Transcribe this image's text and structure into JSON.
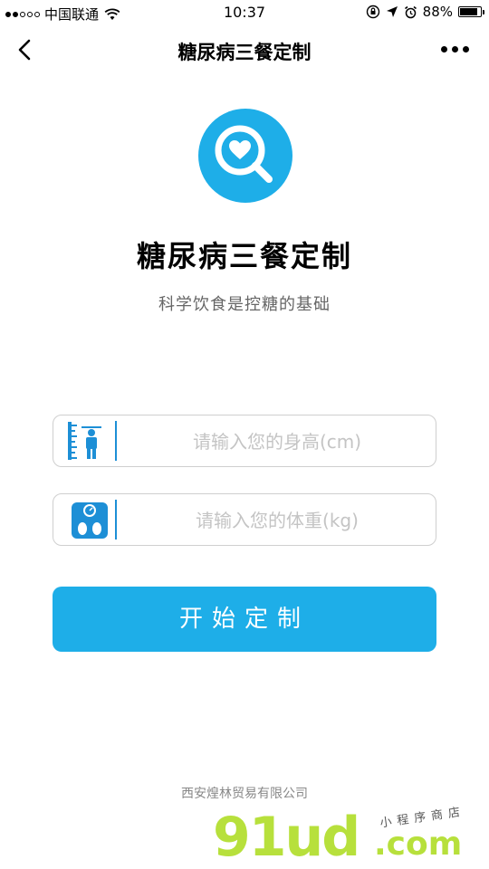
{
  "status_bar": {
    "carrier": "中国联通",
    "time": "10:37",
    "battery": "88%",
    "battery_level": 0.88
  },
  "nav": {
    "title": "糖尿病三餐定制"
  },
  "hero": {
    "title": "糖尿病三餐定制",
    "subtitle": "科学饮食是控糖的基础"
  },
  "form": {
    "height_placeholder": "请输入您的身高(cm)",
    "height_value": "",
    "weight_placeholder": "请输入您的体重(kg)",
    "weight_value": "",
    "submit_label": "开始定制"
  },
  "footer": {
    "company": "西安煌林贸易有限公司"
  },
  "watermark": {
    "main": "91ud",
    "dotcom": ".com",
    "tagline": "小程序商店"
  },
  "colors": {
    "accent": "#1eaee8",
    "icon_blue": "#1d8fd6",
    "watermark_green": "#b7e03c"
  }
}
